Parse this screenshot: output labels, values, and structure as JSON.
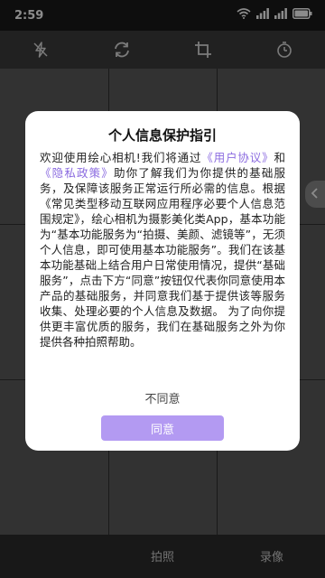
{
  "status_bar": {
    "time": "2:59",
    "icons": [
      "wifi-icon",
      "signal-icon",
      "signal-icon",
      "battery-icon"
    ]
  },
  "toolbar": {
    "icons": [
      "flash-off-icon",
      "switch-camera-icon",
      "crop-icon",
      "timer-icon"
    ]
  },
  "bottom_bar": {
    "tabs": [
      "拍照",
      "录像"
    ]
  },
  "dialog": {
    "title": "个人信息保护指引",
    "body_intro": "欢迎使用绘心相机!我们将通过",
    "link_user_agreement": "《用户协议》",
    "and": "和",
    "link_privacy_policy": "《隐私政策》",
    "body_rest": "助你了解我们为你提供的基础服务，及保障该服务正常运行所必需的信息。根据《常见类型移动互联网应用程序必要个人信息范围规定》，绘心相机为摄影美化类App，基本功能为“基本功能服务为“拍摄、美颜、滤镜等”，无须个人信息，即可使用基本功能服务”。我们在该基本功能基础上结合用户日常使用情况，提供“基础服务”，点击下方“同意”按钮仅代表你同意使用本产品的基础服务，并同意我们基于提供该等服务收集、处理必要的个人信息及数据。 为了向你提供更丰富优质的服务，我们在基础服务之外为你提供各种拍照帮助。",
    "decline_label": "不同意",
    "agree_label": "同意"
  },
  "colors": {
    "accent": "#b39af2",
    "link": "#8b6be0"
  }
}
